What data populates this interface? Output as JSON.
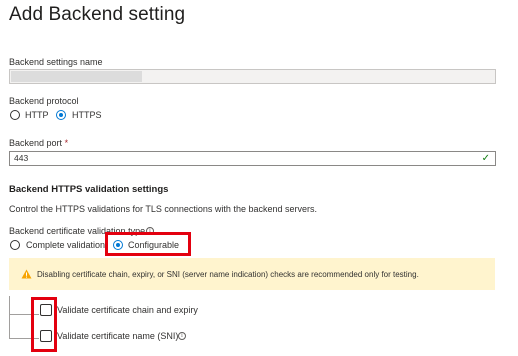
{
  "page": {
    "title": "Add Backend setting"
  },
  "backend_settings_name": {
    "label": "Backend settings name",
    "value": ""
  },
  "backend_protocol": {
    "label": "Backend protocol",
    "options": [
      {
        "label": "HTTP",
        "selected": false
      },
      {
        "label": "HTTPS",
        "selected": true
      }
    ]
  },
  "backend_port": {
    "label": "Backend port",
    "required_marker": "*",
    "value": "443",
    "valid_icon": "checkmark-icon"
  },
  "https_validation": {
    "section_title": "Backend HTTPS validation settings",
    "description": "Control the HTTPS validations for TLS connections with the backend servers.",
    "validation_type_label": "Backend certificate validation type",
    "validation_type_info_icon": "info-icon",
    "options": [
      {
        "label": "Complete validation",
        "selected": false
      },
      {
        "label": "Configurable",
        "selected": true
      }
    ]
  },
  "warning": {
    "icon": "warning-triangle-icon",
    "text": "Disabling certificate chain, expiry, or SNI (server name indication) checks are recommended only for testing."
  },
  "checks": [
    {
      "label": "Validate certificate chain and expiry",
      "checked": false
    },
    {
      "label": "Validate certificate name (SNI)",
      "checked": false,
      "info_icon": "info-icon"
    }
  ],
  "colors": {
    "accent": "#0078d4",
    "highlight": "#e3000f",
    "warning_bg": "#fff4ce",
    "warning_icon": "#f7a400",
    "valid": "#107c10"
  }
}
